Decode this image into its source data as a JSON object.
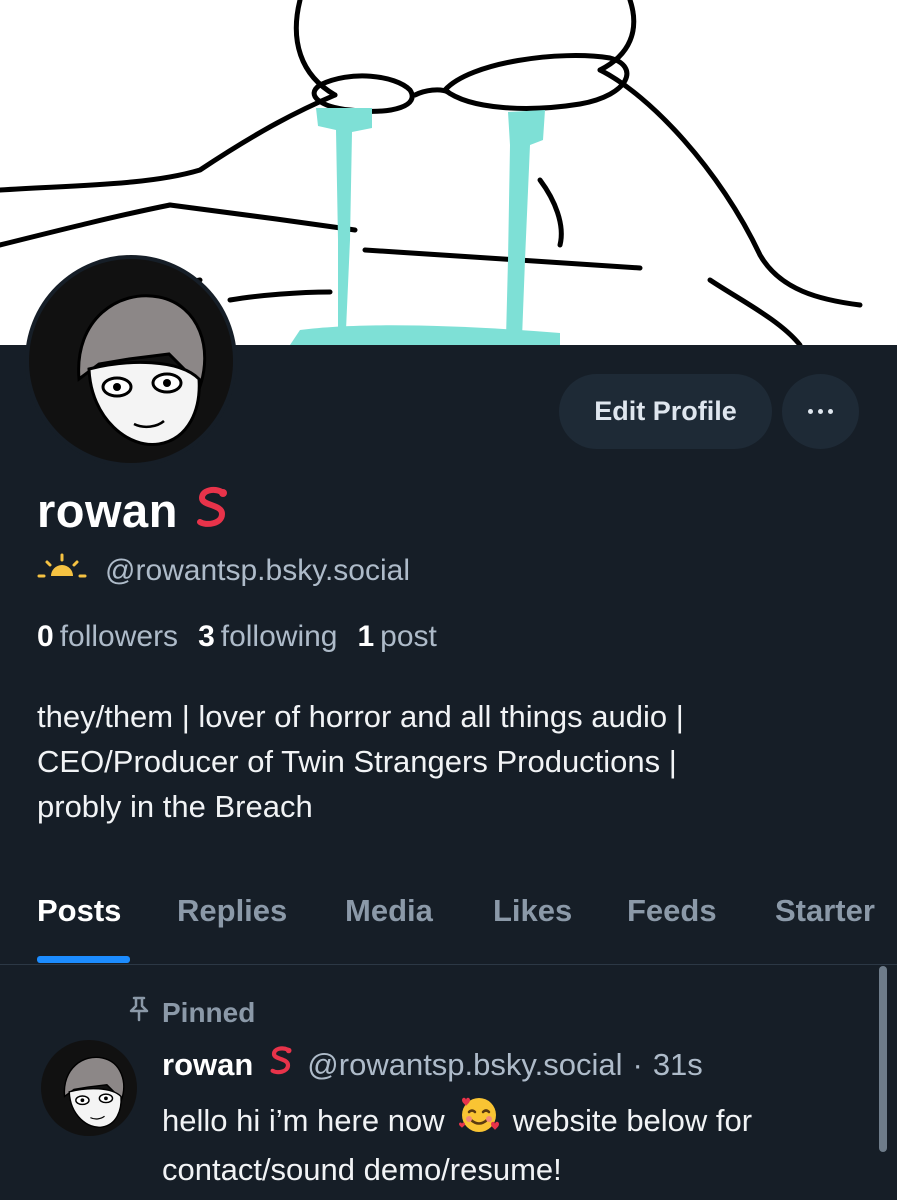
{
  "profile": {
    "display_name": "rowan",
    "name_emoji_icon": "snake-icon",
    "handle": "@rowantsp.bsky.social",
    "handle_emoji_icon": "sunrise-icon",
    "followers_count": "0",
    "followers_label": "followers",
    "following_count": "3",
    "following_label": "following",
    "posts_count": "1",
    "posts_label": "post",
    "bio_lines": [
      "they/them | lover of horror and all things audio |",
      "CEO/Producer of Twin Strangers Productions |",
      "probly in the Breach"
    ]
  },
  "actions": {
    "edit_profile_label": "Edit Profile",
    "more_icon": "more-horizontal-icon"
  },
  "tabs": [
    {
      "label": "Posts",
      "active": true
    },
    {
      "label": "Replies",
      "active": false
    },
    {
      "label": "Media",
      "active": false
    },
    {
      "label": "Likes",
      "active": false
    },
    {
      "label": "Feeds",
      "active": false
    },
    {
      "label": "Starter",
      "active": false
    }
  ],
  "post": {
    "pinned_label": "Pinned",
    "author_name": "rowan",
    "author_handle": "@rowantsp.bsky.social",
    "separator": "·",
    "time": "31s",
    "text_line1_part1": "hello hi i’m here now",
    "text_emoji_icon": "smiling-face-with-hearts-icon",
    "text_line1_part2": "website below for",
    "text_line2": "contact/sound demo/resume!"
  },
  "colors": {
    "background": "#161e27",
    "accent": "#1c8cff",
    "banner_tears": "#7ee0d6",
    "muted_text": "#aebbc9"
  }
}
